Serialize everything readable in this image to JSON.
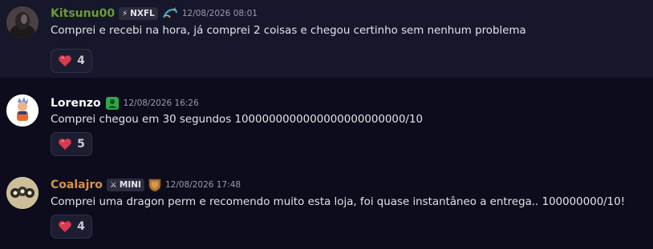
{
  "messages": [
    {
      "username": "Kitsunu00",
      "name_color": "#6a9d2f",
      "tag": "NXFL",
      "tag_icon": "lightning-icon",
      "badge_icon": "dragon-icon",
      "timestamp": "12/08/2026 08:01",
      "text": "Comprei e recebi na hora, já comprei 2 coisas e chegou certinho sem nenhum problema",
      "reaction": {
        "emoji": "heart-icon",
        "count": "4"
      }
    },
    {
      "username": "Lorenzo",
      "name_color": "#ffffff",
      "badge_icon": "green-user-badge-icon",
      "timestamp": "12/08/2026 16:26",
      "text": "Comprei chegou em 30 segundos 1000000000000000000000000/10",
      "reaction": {
        "emoji": "heart-icon",
        "count": "5"
      }
    },
    {
      "username": "Coalajro",
      "name_color": "#d8924a",
      "tag": "MINI",
      "tag_icon": "swords-icon",
      "badge_icon": "bronze-shield-icon",
      "timestamp": "12/08/2026 17:48",
      "text": "Comprei uma dragon perm e recomendo muito esta loja,  foi quase instantâneo a entrega.. 100000000/10!",
      "reaction": {
        "emoji": "heart-icon",
        "count": "4"
      }
    }
  ]
}
